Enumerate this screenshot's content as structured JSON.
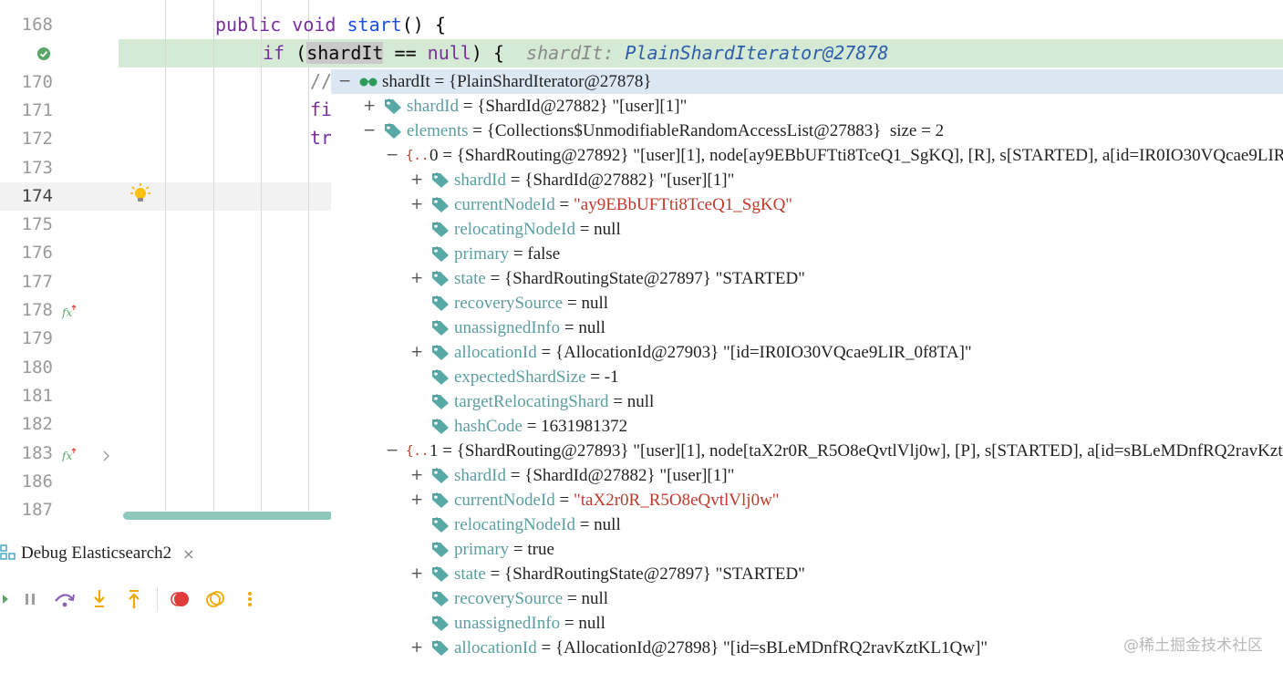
{
  "editor": {
    "lines": [
      {
        "num": "168",
        "current": false,
        "exec": false
      },
      {
        "num": "",
        "current": false,
        "exec": true
      },
      {
        "num": "170",
        "current": false,
        "exec": false
      },
      {
        "num": "171",
        "current": false,
        "exec": false
      },
      {
        "num": "172",
        "current": false,
        "exec": false
      },
      {
        "num": "173",
        "current": false,
        "exec": false
      },
      {
        "num": "174",
        "current": true,
        "exec": false
      },
      {
        "num": "175",
        "current": false,
        "exec": false
      },
      {
        "num": "176",
        "current": false,
        "exec": false
      },
      {
        "num": "177",
        "current": false,
        "exec": false
      },
      {
        "num": "178",
        "current": false,
        "exec": false
      },
      {
        "num": "179",
        "current": false,
        "exec": false
      },
      {
        "num": "180",
        "current": false,
        "exec": false
      },
      {
        "num": "181",
        "current": false,
        "exec": false
      },
      {
        "num": "182",
        "current": false,
        "exec": false
      },
      {
        "num": "183",
        "current": false,
        "exec": false
      },
      {
        "num": "186",
        "current": false,
        "exec": false
      },
      {
        "num": "187",
        "current": false,
        "exec": false
      }
    ],
    "code_line_1": {
      "kw1": "public",
      "kw2": "void",
      "fn": "start",
      "rest": "() {"
    },
    "code_line_2": {
      "kw": "if",
      "open": "(",
      "var": "shardIt",
      "op": " == ",
      "nul": "null",
      "close": ") {",
      "hint_name": "shardIt:",
      "hint_value": "PlainShardIterator@27878"
    },
    "code_line_3": "//",
    "code_line_4": "fi",
    "code_line_5": "tr"
  },
  "debug": {
    "tab_title": "Debug Elasticsearch2",
    "tab_close": "×",
    "toolbar": [
      "resume-icon",
      "pause-icon",
      "step-over-icon",
      "step-into-icon",
      "step-out-icon",
      "breakpoint-icon",
      "mute-breakpoints-icon",
      "more-icon"
    ]
  },
  "tree": [
    {
      "depth": 0,
      "toggle": "−",
      "icon": "watch",
      "name": "shardIt",
      "eq": " = ",
      "value": "{PlainShardIterator@27878}",
      "strval": "",
      "selected": true,
      "plainname": true
    },
    {
      "depth": 1,
      "toggle": "+",
      "icon": "field",
      "name": "shardId",
      "eq": " = ",
      "value": "{ShardId@27882} \"[user][1]\"",
      "strval": ""
    },
    {
      "depth": 1,
      "toggle": "−",
      "icon": "field",
      "name": "elements",
      "eq": " = ",
      "value": "{Collections$UnmodifiableRandomAccessList@27883}  size = 2",
      "strval": ""
    },
    {
      "depth": 2,
      "toggle": "−",
      "icon": "array",
      "name": "0",
      "eq": " = ",
      "value": "{ShardRouting@27892} \"[user][1], node[ay9EBbUFTti8TceQ1_SgKQ], [R], s[STARTED], a[id=IR0IO30VQcae9LIR_0f8TA]\"",
      "strval": "",
      "plainname": true
    },
    {
      "depth": 3,
      "toggle": "+",
      "icon": "field",
      "name": "shardId",
      "eq": " = ",
      "value": "{ShardId@27882} \"[user][1]\"",
      "strval": ""
    },
    {
      "depth": 3,
      "toggle": "+",
      "icon": "field",
      "name": "currentNodeId",
      "eq": " = ",
      "value": "",
      "strval": "\"ay9EBbUFTti8TceQ1_SgKQ\""
    },
    {
      "depth": 3,
      "toggle": "",
      "icon": "field",
      "name": "relocatingNodeId",
      "eq": " = ",
      "value": "null",
      "strval": ""
    },
    {
      "depth": 3,
      "toggle": "",
      "icon": "field",
      "name": "primary",
      "eq": " = ",
      "value": "false",
      "strval": ""
    },
    {
      "depth": 3,
      "toggle": "+",
      "icon": "field",
      "name": "state",
      "eq": " = ",
      "value": "{ShardRoutingState@27897} \"STARTED\"",
      "strval": ""
    },
    {
      "depth": 3,
      "toggle": "",
      "icon": "field",
      "name": "recoverySource",
      "eq": " = ",
      "value": "null",
      "strval": ""
    },
    {
      "depth": 3,
      "toggle": "",
      "icon": "field",
      "name": "unassignedInfo",
      "eq": " = ",
      "value": "null",
      "strval": ""
    },
    {
      "depth": 3,
      "toggle": "+",
      "icon": "field",
      "name": "allocationId",
      "eq": " = ",
      "value": "{AllocationId@27903} \"[id=IR0IO30VQcae9LIR_0f8TA]\"",
      "strval": ""
    },
    {
      "depth": 3,
      "toggle": "",
      "icon": "field",
      "name": "expectedShardSize",
      "eq": " = ",
      "value": "-1",
      "strval": ""
    },
    {
      "depth": 3,
      "toggle": "",
      "icon": "field",
      "name": "targetRelocatingShard",
      "eq": " = ",
      "value": "null",
      "strval": ""
    },
    {
      "depth": 3,
      "toggle": "",
      "icon": "field",
      "name": "hashCode",
      "eq": " = ",
      "value": "1631981372",
      "strval": ""
    },
    {
      "depth": 2,
      "toggle": "−",
      "icon": "array",
      "name": "1",
      "eq": " = ",
      "value": "{ShardRouting@27893} \"[user][1], node[taX2r0R_R5O8eQvtlVlj0w], [P], s[STARTED], a[id=sBLeMDnfRQ2ravKztKL1Qw]\"",
      "strval": "",
      "plainname": true
    },
    {
      "depth": 3,
      "toggle": "+",
      "icon": "field",
      "name": "shardId",
      "eq": " = ",
      "value": "{ShardId@27882} \"[user][1]\"",
      "strval": ""
    },
    {
      "depth": 3,
      "toggle": "+",
      "icon": "field",
      "name": "currentNodeId",
      "eq": " = ",
      "value": "",
      "strval": "\"taX2r0R_R5O8eQvtlVlj0w\""
    },
    {
      "depth": 3,
      "toggle": "",
      "icon": "field",
      "name": "relocatingNodeId",
      "eq": " = ",
      "value": "null",
      "strval": ""
    },
    {
      "depth": 3,
      "toggle": "",
      "icon": "field",
      "name": "primary",
      "eq": " = ",
      "value": "true",
      "strval": ""
    },
    {
      "depth": 3,
      "toggle": "+",
      "icon": "field",
      "name": "state",
      "eq": " = ",
      "value": "{ShardRoutingState@27897} \"STARTED\"",
      "strval": ""
    },
    {
      "depth": 3,
      "toggle": "",
      "icon": "field",
      "name": "recoverySource",
      "eq": " = ",
      "value": "null",
      "strval": ""
    },
    {
      "depth": 3,
      "toggle": "",
      "icon": "field",
      "name": "unassignedInfo",
      "eq": " = ",
      "value": "null",
      "strval": ""
    },
    {
      "depth": 3,
      "toggle": "+",
      "icon": "field",
      "name": "allocationId",
      "eq": " = ",
      "value": "{AllocationId@27898} \"[id=sBLeMDnfRQ2ravKztKL1Qw]\"",
      "strval": ""
    }
  ],
  "watermark": "@稀土掘金技术社区",
  "colors": {
    "exec_line": "#d4ead4",
    "selected_row": "#dbe7f3",
    "field_name": "#5b9ea0",
    "string_value": "#c0392b",
    "keyword": "#7a2fa0",
    "function": "#1750eb"
  }
}
